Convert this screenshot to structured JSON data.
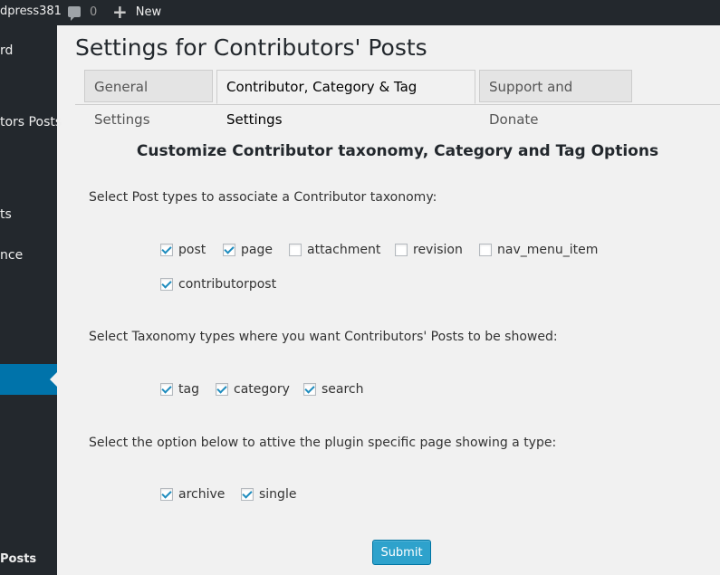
{
  "admin_bar": {
    "site_name": "dpress381",
    "comment_count": "0",
    "new_label": "New"
  },
  "sidebar": {
    "items": [
      {
        "label": "rd"
      },
      {
        "label": "tors Posts"
      },
      {
        "label": "ts"
      },
      {
        "label": "nce"
      },
      {
        "label": "Posts"
      }
    ]
  },
  "page": {
    "title": "Settings for Contributors' Posts",
    "tabs": [
      {
        "label": "General Settings"
      },
      {
        "label": "Contributor, Category & Tag Settings"
      },
      {
        "label": "Support and Donate"
      }
    ],
    "heading": "Customize Contributor taxonomy, Category and Tag Options",
    "post_types_label": "Select Post types to associate a Contributor taxonomy:",
    "post_types": [
      {
        "label": "post",
        "checked": true
      },
      {
        "label": "page",
        "checked": true
      },
      {
        "label": "attachment",
        "checked": false
      },
      {
        "label": "revision",
        "checked": false
      },
      {
        "label": "nav_menu_item",
        "checked": false
      },
      {
        "label": "contributorpost",
        "checked": true
      }
    ],
    "taxonomy_label": "Select Taxonomy types where you want Contributors' Posts to be showed:",
    "taxonomies": [
      {
        "label": "tag",
        "checked": true
      },
      {
        "label": "category",
        "checked": true
      },
      {
        "label": "search",
        "checked": true
      }
    ],
    "page_type_label": "Select the option below to attive the plugin specific page showing a type:",
    "page_types": [
      {
        "label": "archive",
        "checked": true
      },
      {
        "label": "single",
        "checked": true
      }
    ],
    "submit_label": "Submit"
  }
}
